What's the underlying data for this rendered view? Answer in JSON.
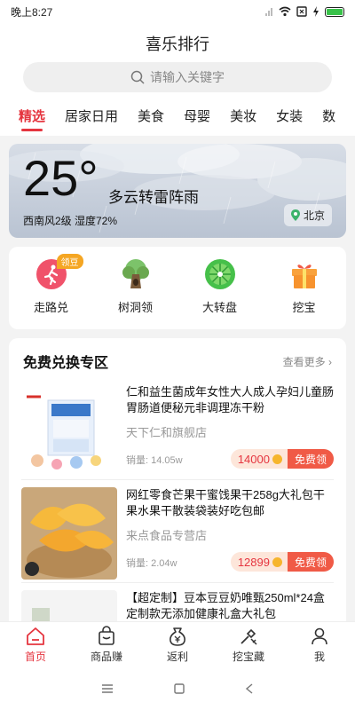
{
  "status": {
    "time": "晚上8:27"
  },
  "header": {
    "title": "喜乐排行"
  },
  "search": {
    "placeholder": "请输入关键字"
  },
  "tabs": [
    "精选",
    "居家日用",
    "美食",
    "母婴",
    "美妆",
    "女装",
    "数"
  ],
  "weather": {
    "temperature": "25°",
    "condition": "多云转雷阵雨",
    "details": "西南风2级 湿度72%",
    "city": "北京"
  },
  "features": [
    {
      "label": "走路兑",
      "badge": "领豆",
      "icon": "walking-icon",
      "color": "#f0526a"
    },
    {
      "label": "树洞领",
      "icon": "tree-hollow-icon",
      "color": "#6aa84f"
    },
    {
      "label": "大转盘",
      "icon": "wheel-icon",
      "color": "#46c04a"
    },
    {
      "label": "挖宝",
      "icon": "gift-box-icon",
      "color": "#f7932e"
    }
  ],
  "deals": {
    "title": "免费兑换专区",
    "more": "查看更多",
    "items": [
      {
        "name": "仁和益生菌成年女性大人成人孕妇儿童肠胃肠道便秘元非调理冻干粉",
        "shop": "天下仁和旗舰店",
        "sales": "销量: 14.05w",
        "price": "14000",
        "claim": "免费领"
      },
      {
        "name": "网红零食芒果干蜜饯果干258g大礼包干果水果干散装袋装好吃包邮",
        "shop": "来点食品专营店",
        "sales": "销量: 2.04w",
        "price": "12899",
        "claim": "免费领"
      },
      {
        "name": "【超定制】豆本豆豆奶唯甄250ml*24盒定制款无添加健康礼盒大礼包"
      }
    ]
  },
  "bottom_nav": [
    {
      "label": "首页",
      "icon": "home-icon"
    },
    {
      "label": "商品赚",
      "icon": "shopping-bag-icon"
    },
    {
      "label": "返利",
      "icon": "money-bag-icon"
    },
    {
      "label": "挖宝藏",
      "icon": "shovel-icon"
    },
    {
      "label": "我",
      "icon": "person-icon"
    }
  ],
  "colors": {
    "accent": "#e5353f",
    "claim": "#f05a46",
    "coin": "#f6b52d"
  }
}
